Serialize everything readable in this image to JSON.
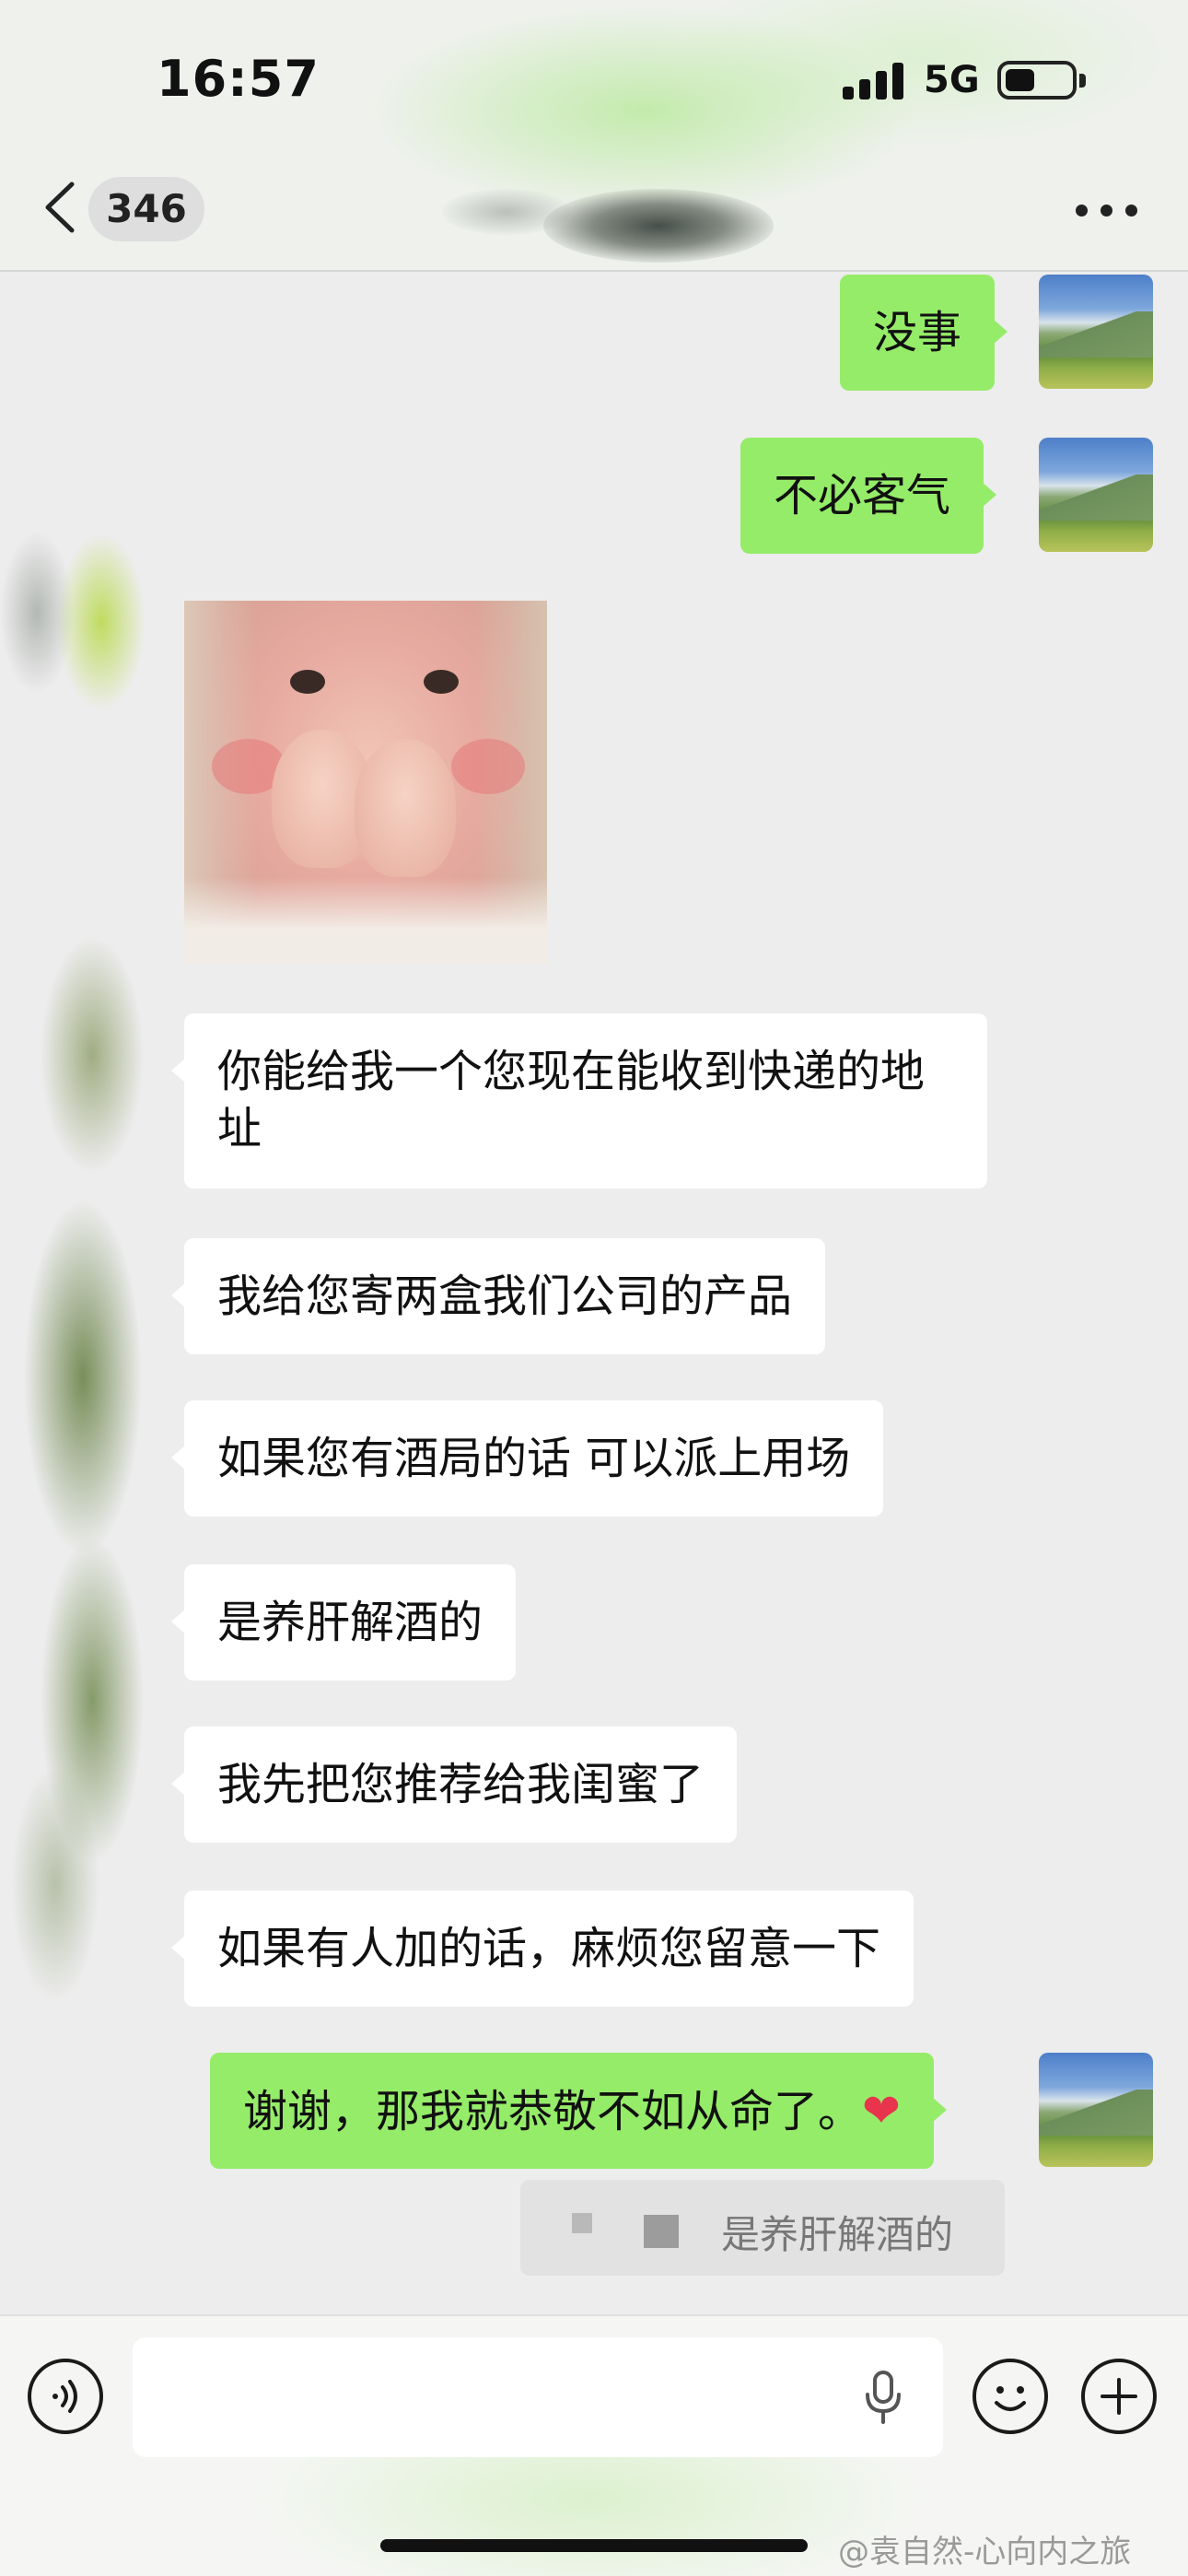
{
  "status_bar": {
    "time": "16:57",
    "network": "5G",
    "battery_level": 0.45
  },
  "header": {
    "unread_count": "346"
  },
  "messages": [
    {
      "from": "me",
      "type": "text",
      "text": "没事"
    },
    {
      "from": "me",
      "type": "text",
      "text": "不必客气"
    },
    {
      "from": "them",
      "type": "sticker",
      "sticker": "baby-fists-sticker"
    },
    {
      "from": "them",
      "type": "text",
      "text": "你能给我一个您现在能收到快递的地址"
    },
    {
      "from": "them",
      "type": "text",
      "text": "我给您寄两盒我们公司的产品"
    },
    {
      "from": "them",
      "type": "text",
      "text": "如果您有酒局的话 可以派上用场"
    },
    {
      "from": "them",
      "type": "text",
      "text": "是养肝解酒的"
    },
    {
      "from": "them",
      "type": "text",
      "text": "我先把您推荐给我闺蜜了"
    },
    {
      "from": "them",
      "type": "text",
      "text": "如果有人加的话，麻烦您留意一下"
    },
    {
      "from": "me",
      "type": "text",
      "text": "谢谢，那我就恭敬不如从命了。",
      "emoji": "❤"
    }
  ],
  "quote": {
    "text": "是养肝解酒的"
  },
  "input_bar": {
    "value": "",
    "placeholder": ""
  },
  "watermark": "@袁自然-心向内之旅",
  "icons": {
    "back": "chevron-left-icon",
    "more": "more-dots-icon",
    "voice": "voice-input-icon",
    "mic": "microphone-icon",
    "emoji": "emoji-icon",
    "plus": "plus-icon"
  },
  "colors": {
    "my_bubble": "#95ec69",
    "their_bubble": "#ffffff",
    "chat_background": "#ededed",
    "heart": "#e8344d"
  }
}
